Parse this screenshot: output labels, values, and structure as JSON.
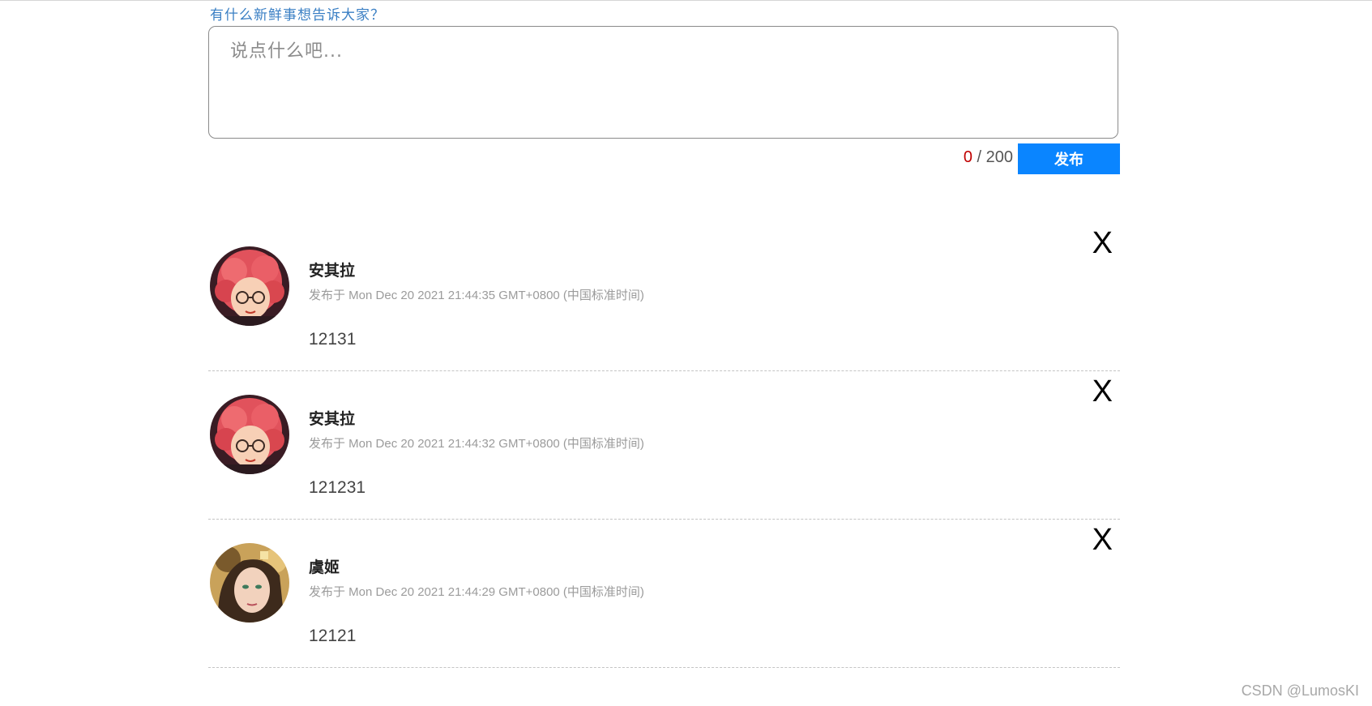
{
  "composer": {
    "prompt": "有什么新鲜事想告诉大家？",
    "placeholder": "说点什么吧...",
    "count_current": "0",
    "count_separator": " / ",
    "count_max": "200",
    "publish_label": "发布"
  },
  "posts": [
    {
      "name": "安其拉",
      "time": "发布于 Mon Dec 20 2021 21:44:35 GMT+0800 (中国标准时间)",
      "content": "12131",
      "delete_label": "X",
      "avatar_icon": "angela-avatar-icon"
    },
    {
      "name": "安其拉",
      "time": "发布于 Mon Dec 20 2021 21:44:32 GMT+0800 (中国标准时间)",
      "content": "121231",
      "delete_label": "X",
      "avatar_icon": "angela-avatar-icon"
    },
    {
      "name": "虞姬",
      "time": "发布于 Mon Dec 20 2021 21:44:29 GMT+0800 (中国标准时间)",
      "content": "12121",
      "delete_label": "X",
      "avatar_icon": "yuji-avatar-icon"
    }
  ],
  "watermark": "CSDN @LumosKI",
  "colors": {
    "accent": "#0a85ff",
    "count_current": "#c00000",
    "prompt": "#3a7fc4"
  }
}
